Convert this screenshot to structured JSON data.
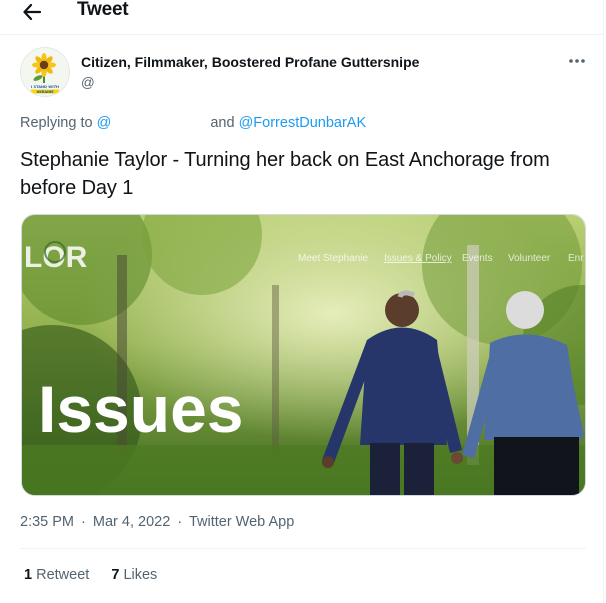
{
  "header": {
    "title": "Tweet"
  },
  "tweet": {
    "author": {
      "name": "Citizen, Filmmaker, Boostered Profane Guttersnipe",
      "handle": "@",
      "avatar_caption": "I STAND WITH UKRAINE"
    },
    "reply": {
      "prefix": "Replying to",
      "mention1": "@",
      "connector": "and",
      "mention2": "@ForrestDunbarAK"
    },
    "text": "Stephanie Taylor - Turning her back on East Anchorage from before Day 1",
    "media": {
      "overlay_title": "Issues",
      "logo_text": "LOR",
      "nav_items": [
        "Meet Stephanie",
        "Issues & Policy",
        "Events",
        "Volunteer",
        "Enr"
      ]
    },
    "meta": {
      "time": "2:35 PM",
      "date": "Mar 4, 2022",
      "app": "Twitter Web App",
      "separator": "·"
    },
    "stats": {
      "retweets_count": "1",
      "retweets_label": "Retweet",
      "likes_count": "7",
      "likes_label": "Likes"
    }
  },
  "colors": {
    "accent": "#1d9bf0",
    "secondary_text": "#536471",
    "primary_text": "#0f1419"
  },
  "icons": {
    "back": "arrow-left-icon",
    "more": "more-horizontal-icon"
  }
}
